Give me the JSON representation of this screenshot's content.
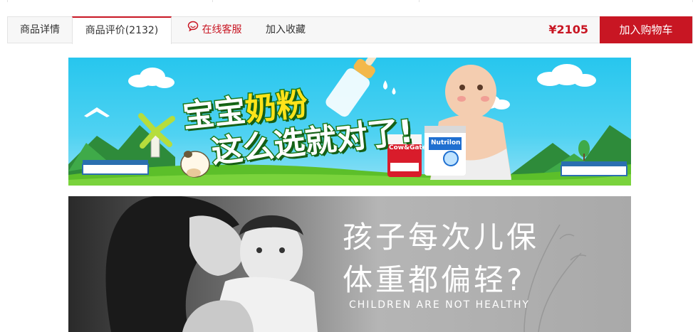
{
  "nav": {
    "tab_details": "商品详情",
    "tab_reviews": "商品评价(2132)",
    "tab_service": "在线客服",
    "tab_favorite": "加入收藏",
    "price": "¥2105",
    "add_to_cart": "加入购物车"
  },
  "banner_milk": {
    "headline_line1_a": "宝宝",
    "headline_line1_b": "奶粉",
    "headline_line2": "这么选就对了!",
    "can1_text": "Cow&Gate",
    "can2_text": "Nutrilon"
  },
  "banner_mom": {
    "headline_line1": "孩子每次儿保",
    "headline_line2": "体重都偏轻?",
    "subtitle": "CHILDREN ARE NOT HEALTHY"
  },
  "colors": {
    "accent": "#c81623",
    "banner_sky": "#27c6ee",
    "grass": "#5cbf2a"
  },
  "icons": [
    "chat-bubble-icon"
  ]
}
